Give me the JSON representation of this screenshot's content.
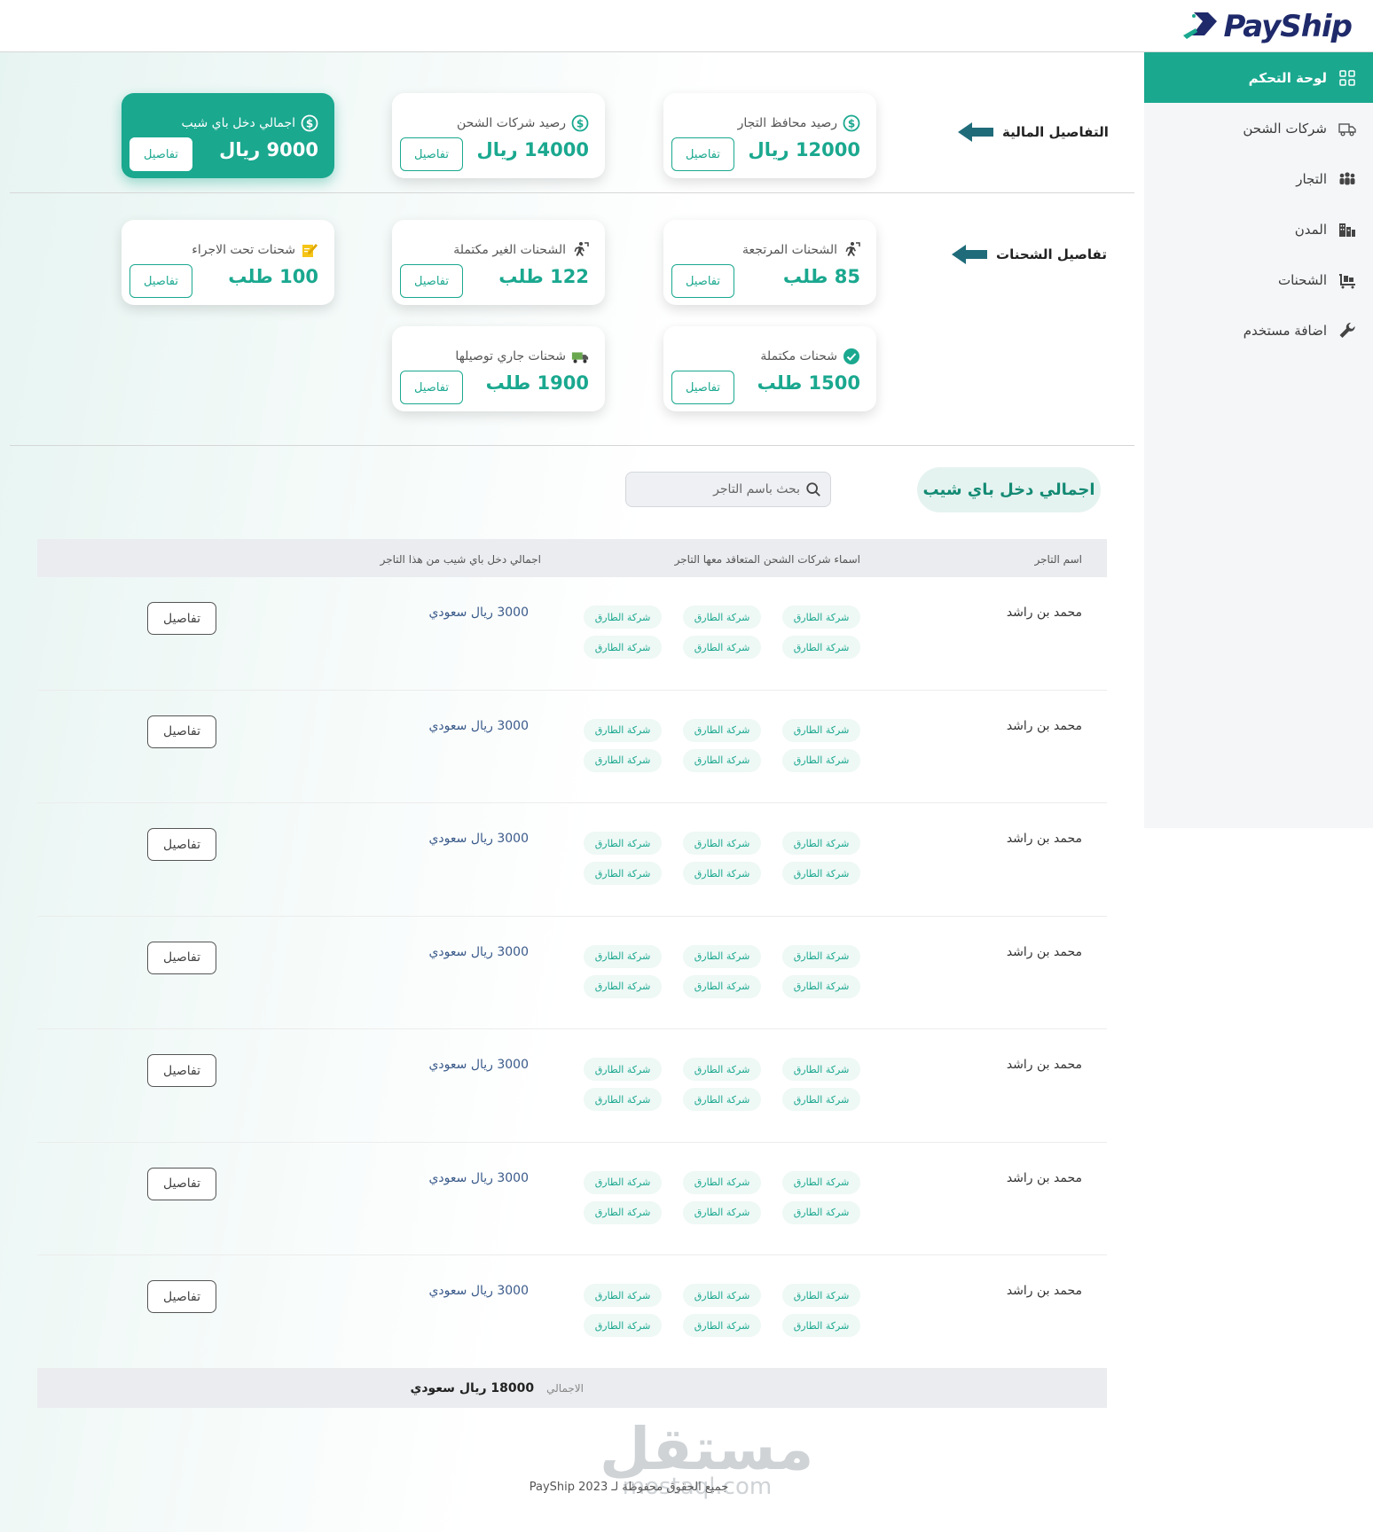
{
  "brand": {
    "name": "PayShip"
  },
  "sidebar": {
    "items": [
      {
        "label": "لوحة التحكم",
        "icon": "grid-icon",
        "active": true
      },
      {
        "label": "شركات الشحن",
        "icon": "delivery-truck-icon",
        "active": false
      },
      {
        "label": "التجار",
        "icon": "users-group-icon",
        "active": false
      },
      {
        "label": "المدن",
        "icon": "city-buildings-icon",
        "active": false
      },
      {
        "label": "الشحنات",
        "icon": "cart-box-icon",
        "active": false
      },
      {
        "label": "اضافة مستخدم",
        "icon": "wrench-icon",
        "active": false
      }
    ]
  },
  "sections": {
    "financial": "التفاصيل المالية",
    "shipments": "تفاصيل الشحنات"
  },
  "financial_cards": [
    {
      "title": "رصيد محافظ التجار",
      "value": "12000 ريال",
      "button": "تفاصيل",
      "icon": "dollar-circle-icon"
    },
    {
      "title": "رصيد شركات الشحن",
      "value": "14000 ريال",
      "button": "تفاصيل",
      "icon": "dollar-circle-icon"
    },
    {
      "title": "اجمالي دخل باي شيب",
      "value": "9000 ريال",
      "button": "تفاصيل",
      "icon": "dollar-circle-icon"
    }
  ],
  "shipment_cards": [
    {
      "title": "الشحنات المرتجعة",
      "value": "85 طلب",
      "button": "تفاصيل",
      "icon": "runner-return-icon"
    },
    {
      "title": "الشحنات الغير مكتملة",
      "value": "122 طلب",
      "button": "تفاصيل",
      "icon": "runner-return-icon"
    },
    {
      "title": "شحنات تحت الاجراء",
      "value": "100 طلب",
      "button": "تفاصيل",
      "icon": "pencil-note-icon"
    },
    {
      "title": "شحنات مكتملة",
      "value": "1500 طلب",
      "button": "تفاصيل",
      "icon": "check-circle-icon"
    },
    {
      "title": "شحنات جاري توصيلها",
      "value": "1900 طلب",
      "button": "تفاصيل",
      "icon": "truck-icon"
    }
  ],
  "income_section": {
    "title": "اجمالي دخل باي شيب",
    "search_placeholder": "بحث باسم التاجر"
  },
  "table": {
    "headers": {
      "merchant": "اسم التاجر",
      "companies": "اسماء شركات الشحن المتعاقد معها التاجر",
      "total": "اجمالي دخل باي شيب من هذا التاجر"
    },
    "rows": [
      {
        "merchant": "محمد بن راشد",
        "companies": [
          "شركة الطارق",
          "شركة الطارق",
          "شركة الطارق",
          "شركة الطارق",
          "شركة الطارق",
          "شركة الطارق"
        ],
        "total": "3000 ريال سعودي",
        "button": "تفاصيل"
      },
      {
        "merchant": "محمد بن راشد",
        "companies": [
          "شركة الطارق",
          "شركة الطارق",
          "شركة الطارق",
          "شركة الطارق",
          "شركة الطارق",
          "شركة الطارق"
        ],
        "total": "3000 ريال سعودي",
        "button": "تفاصيل"
      },
      {
        "merchant": "محمد بن راشد",
        "companies": [
          "شركة الطارق",
          "شركة الطارق",
          "شركة الطارق",
          "شركة الطارق",
          "شركة الطارق",
          "شركة الطارق"
        ],
        "total": "3000 ريال سعودي",
        "button": "تفاصيل"
      },
      {
        "merchant": "محمد بن راشد",
        "companies": [
          "شركة الطارق",
          "شركة الطارق",
          "شركة الطارق",
          "شركة الطارق",
          "شركة الطارق",
          "شركة الطارق"
        ],
        "total": "3000 ريال سعودي",
        "button": "تفاصيل"
      },
      {
        "merchant": "محمد بن راشد",
        "companies": [
          "شركة الطارق",
          "شركة الطارق",
          "شركة الطارق",
          "شركة الطارق",
          "شركة الطارق",
          "شركة الطارق"
        ],
        "total": "3000 ريال سعودي",
        "button": "تفاصيل"
      },
      {
        "merchant": "محمد بن راشد",
        "companies": [
          "شركة الطارق",
          "شركة الطارق",
          "شركة الطارق",
          "شركة الطارق",
          "شركة الطارق",
          "شركة الطارق"
        ],
        "total": "3000 ريال سعودي",
        "button": "تفاصيل"
      },
      {
        "merchant": "محمد بن راشد",
        "companies": [
          "شركة الطارق",
          "شركة الطارق",
          "شركة الطارق",
          "شركة الطارق",
          "شركة الطارق",
          "شركة الطارق"
        ],
        "total": "3000 ريال سعودي",
        "button": "تفاصيل"
      }
    ],
    "footer": {
      "label": "الاجمالي",
      "sum": "18000 ريال سعودي"
    }
  },
  "watermark": {
    "arabic": "مستقل",
    "latin": "mostaql.com"
  },
  "footer": {
    "copyright": "جميع الحقوق محفوظة لـ PayShip 2023"
  },
  "colors": {
    "accent": "#1aa88f",
    "brand_navy": "#1f2a6b",
    "arrow": "#1f6b7a"
  }
}
